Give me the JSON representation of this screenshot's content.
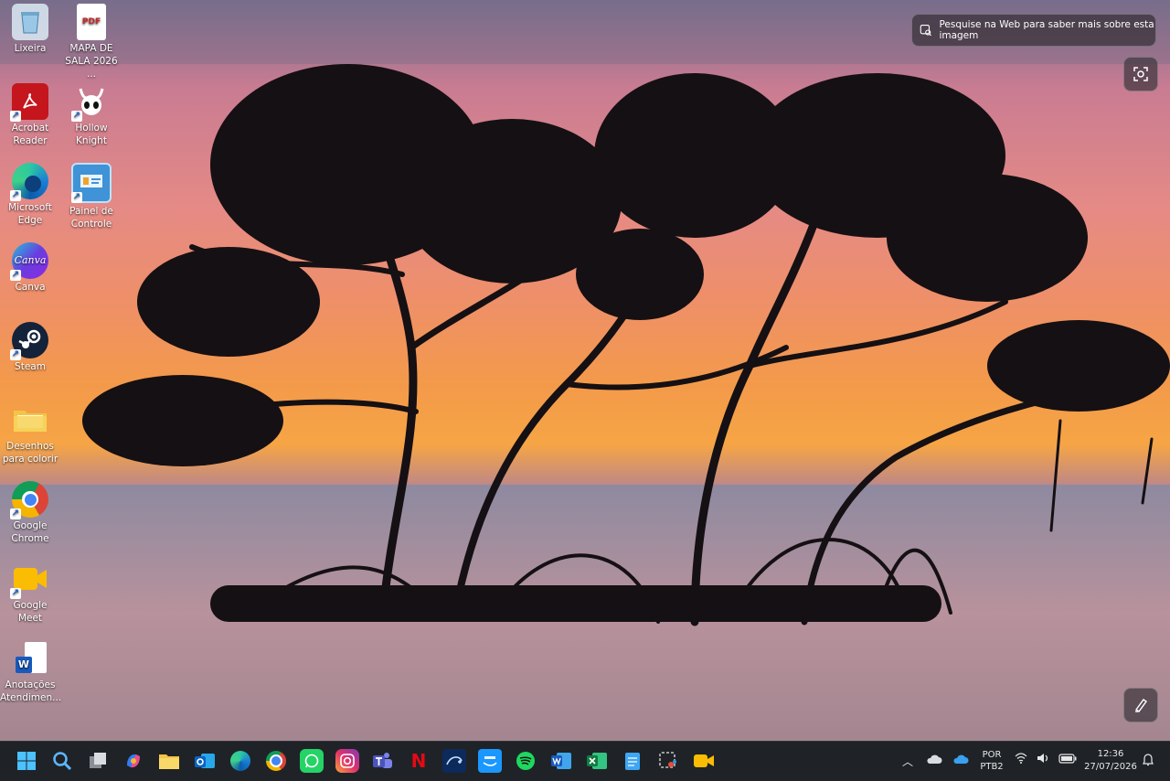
{
  "desktop": {
    "icons": [
      {
        "label": "Lixeira",
        "icon": "recycle-bin-icon"
      },
      {
        "label": "MAPA DE SALA 2026 ...",
        "icon": "pdf-file-icon"
      },
      {
        "label": "Acrobat Reader",
        "icon": "acrobat-icon"
      },
      {
        "label": "Hollow Knight",
        "icon": "hollow-knight-icon"
      },
      {
        "label": "Microsoft Edge",
        "icon": "edge-icon"
      },
      {
        "label": "Painel de Controle",
        "icon": "control-panel-icon"
      },
      {
        "label": "Canva",
        "icon": "canva-icon"
      },
      {
        "label": "Steam",
        "icon": "steam-icon"
      },
      {
        "label": "Desenhos para colorir",
        "icon": "folder-icon"
      },
      {
        "label": "Google Chrome",
        "icon": "chrome-icon"
      },
      {
        "label": "Google Meet",
        "icon": "meet-icon"
      },
      {
        "label": "Anotações Atendimen...",
        "icon": "word-doc-icon"
      }
    ],
    "pdf_badge": "PDF",
    "canva_text": "Canva"
  },
  "lens": {
    "chip_text": "Pesquise na Web para saber mais sobre esta imagem"
  },
  "taskbar": {
    "apps": [
      {
        "name": "start-button",
        "icon": "windows-icon"
      },
      {
        "name": "search",
        "icon": "search-icon"
      },
      {
        "name": "task-view",
        "icon": "task-view-icon"
      },
      {
        "name": "copilot",
        "icon": "copilot-icon"
      },
      {
        "name": "file-explorer",
        "icon": "folder-icon"
      },
      {
        "name": "outlook",
        "icon": "outlook-icon"
      },
      {
        "name": "edge",
        "icon": "edge-icon"
      },
      {
        "name": "chrome",
        "icon": "chrome-icon"
      },
      {
        "name": "whatsapp",
        "icon": "whatsapp-icon"
      },
      {
        "name": "instagram",
        "icon": "instagram-icon"
      },
      {
        "name": "teams",
        "icon": "teams-icon"
      },
      {
        "name": "netflix",
        "icon": "netflix-icon"
      },
      {
        "name": "disney-plus",
        "icon": "disney-plus-icon"
      },
      {
        "name": "prime-video",
        "icon": "prime-video-icon"
      },
      {
        "name": "spotify",
        "icon": "spotify-icon"
      },
      {
        "name": "word",
        "icon": "word-icon"
      },
      {
        "name": "excel",
        "icon": "excel-icon"
      },
      {
        "name": "notepad",
        "icon": "notepad-icon"
      },
      {
        "name": "snipping-tool",
        "icon": "snipping-icon"
      },
      {
        "name": "zoom",
        "icon": "camera-icon"
      }
    ],
    "netflix_letter": "N",
    "language": "POR",
    "layout": "PTB2",
    "time": "12:36",
    "date": "27/07/2026"
  }
}
